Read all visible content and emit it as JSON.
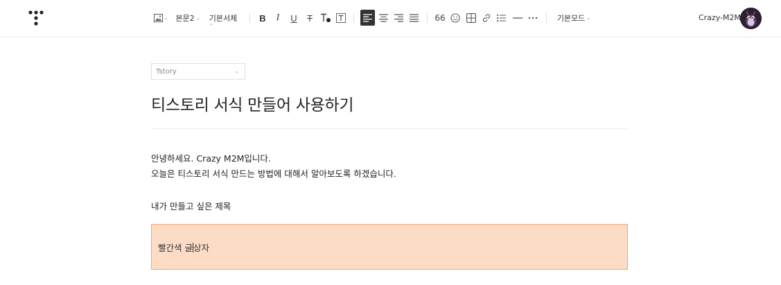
{
  "toolbar": {
    "paragraph_style": "본문2",
    "font_family": "기본서체",
    "quote_label": "66",
    "mode": "기본모드"
  },
  "user": {
    "name": "Crazy-M2M"
  },
  "editor": {
    "category": "Tstory",
    "title": "티스토리 서식 만들어 사용하기",
    "lines": [
      "안녕하세요. Crazy M2M입니다.",
      "오늘은 티스토리 서식 만드는 방법에 대해서 알아보도록 하겠습니다.",
      "내가 만들고 싶은 제목"
    ],
    "red_box_text_before": "빨간색 글",
    "red_box_text_after": "상자"
  },
  "colors": {
    "red_box_fill": "#fddcc6",
    "red_box_border": "#f0a46c",
    "active_align": "#333333"
  }
}
